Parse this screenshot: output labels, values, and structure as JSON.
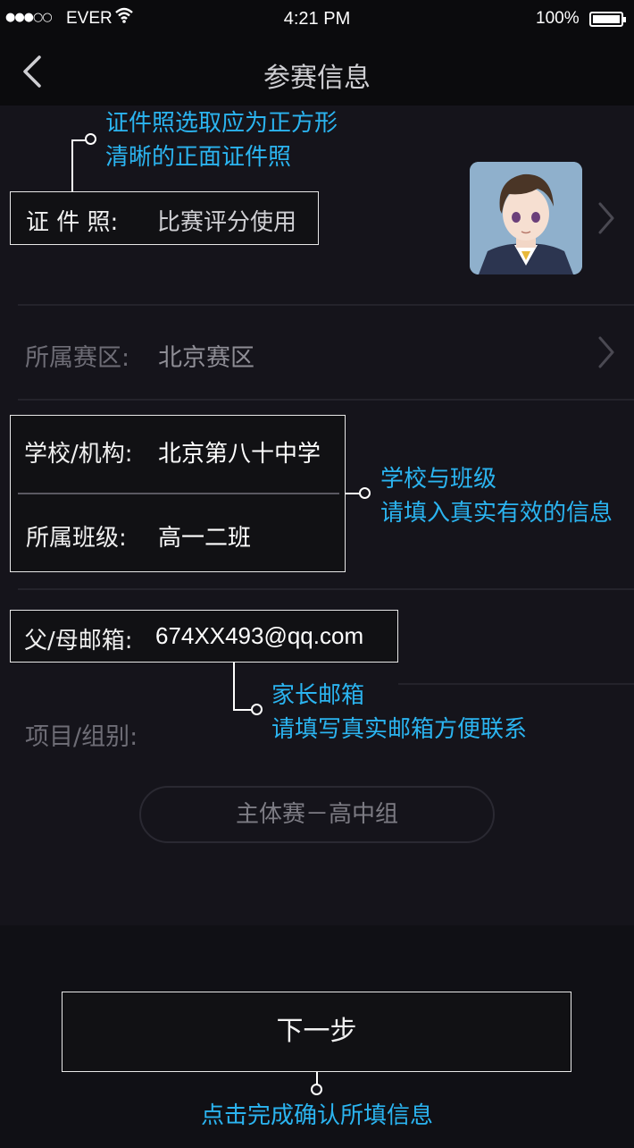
{
  "status_bar": {
    "signal": "●●●○○",
    "carrier": "EVER",
    "time": "4:21 PM",
    "battery": "100%"
  },
  "nav": {
    "title": "参赛信息"
  },
  "photo": {
    "label": "证 件 照:",
    "value": "比赛评分使用",
    "callout": [
      "证件照选取应为正方形",
      "清晰的正面证件照"
    ]
  },
  "region": {
    "label": "所属赛区:",
    "value": "北京赛区"
  },
  "school": {
    "label": "学校/机构:",
    "value": "北京第八十中学",
    "class_label": "所属班级:",
    "class_value": "高一二班",
    "callout": [
      "学校与班级",
      "请填入真实有效的信息"
    ]
  },
  "email": {
    "label": "父/母邮箱:",
    "value": "674XX493@qq.com",
    "callout": [
      "家长邮箱",
      "请填写真实邮箱方便联系"
    ]
  },
  "project": {
    "label": "项目/组别:",
    "option": "主体赛－高中组"
  },
  "next_button": {
    "label": "下一步",
    "callout": "点击完成确认所填信息"
  },
  "colors": {
    "background": "#15141b",
    "accent": "#2bb4f0",
    "bar": "#0b0b0d"
  }
}
